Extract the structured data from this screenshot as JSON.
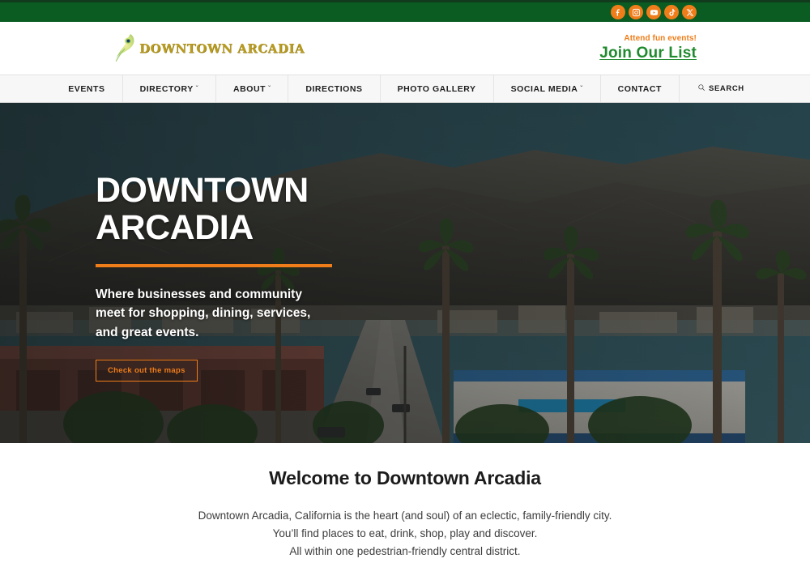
{
  "topbar": {
    "social": [
      {
        "name": "facebook-icon",
        "label": "Facebook"
      },
      {
        "name": "instagram-icon",
        "label": "Instagram"
      },
      {
        "name": "youtube-icon",
        "label": "YouTube"
      },
      {
        "name": "tiktok-icon",
        "label": "TikTok"
      },
      {
        "name": "x-twitter-icon",
        "label": "X"
      }
    ],
    "background_color": "#0a5c23",
    "icon_color": "#ef7d19"
  },
  "header": {
    "logo_icon": "peacock-feather-icon",
    "brand_name": "DOWNTOWN ARCADIA",
    "brand_color": "#b99b1e",
    "join_kicker": "Attend fun events!",
    "join_label": "Join Our List",
    "join_color": "#1f8a2e",
    "kicker_color": "#ef7d19"
  },
  "nav": {
    "items": [
      {
        "label": "EVENTS",
        "has_dropdown": false
      },
      {
        "label": "DIRECTORY",
        "has_dropdown": true
      },
      {
        "label": "ABOUT",
        "has_dropdown": true
      },
      {
        "label": "DIRECTIONS",
        "has_dropdown": false
      },
      {
        "label": "PHOTO GALLERY",
        "has_dropdown": false
      },
      {
        "label": "SOCIAL MEDIA",
        "has_dropdown": true
      },
      {
        "label": "CONTACT",
        "has_dropdown": false
      }
    ],
    "search_label": "SEARCH",
    "caret_glyph": "ˇ"
  },
  "hero": {
    "title_line1": "DOWNTOWN",
    "title_line2": "ARCADIA",
    "subtitle": "Where businesses and community meet for shopping, dining, services, and great events.",
    "button_label": "Check out the maps",
    "accent_color": "#ef7d19",
    "sky_color": "#2e5663"
  },
  "welcome": {
    "title": "Welcome to Downtown Arcadia",
    "line1": "Downtown Arcadia, California is the heart (and soul) of an eclectic, family-friendly city.",
    "line2": "You’ll find places to eat, drink, shop, play and discover.",
    "line3": "All within one pedestrian-friendly central district."
  }
}
